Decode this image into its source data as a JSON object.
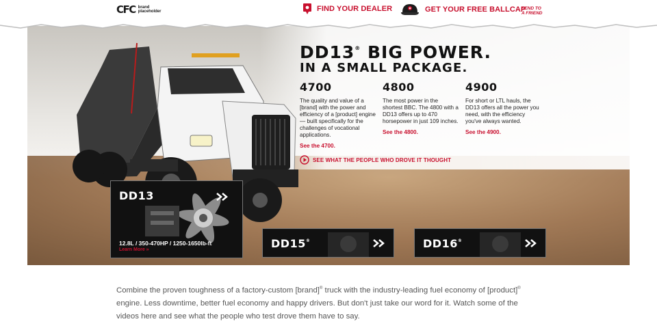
{
  "logo": {
    "main": "CFC",
    "sub_line1": "brand",
    "sub_line2": "placeholder"
  },
  "nav": {
    "dealer_label": "FIND YOUR DEALER",
    "ballcap_label": "GET YOUR FREE BALLCAP",
    "send_line1": "SEND TO",
    "send_line2": "A FRIEND"
  },
  "hero": {
    "headline_main": "DD13",
    "headline_reg": "®",
    "headline_rest": " BIG POWER.",
    "headline_line2": "IN A SMALL PACKAGE.",
    "models": [
      {
        "number": "4700",
        "description": "The quality and value of a [brand] with the power and efficiency of a [product] engine — built specifically for the challenges of vocational applications.",
        "link": "See the 4700."
      },
      {
        "number": "4800",
        "description": "The most power in the shortest BBC. The 4800 with a DD13 offers up to 470 horsepower in just 109 inches.",
        "link": "See the 4800."
      },
      {
        "number": "4900",
        "description": "For short or LTL hauls, the DD13 offers all the power you need, with the efficiency you've always wanted.",
        "link": "See the 4900."
      }
    ],
    "see_people": "SEE WHAT THE PEOPLE WHO DROVE IT THOUGHT"
  },
  "engines": {
    "dd13": {
      "title": "DD13",
      "reg": "",
      "spec": "12.8L / 350-470HP / 1250-1650lb-ft",
      "learn": "Learn More »"
    },
    "dd15": {
      "title": "DD15",
      "reg": "®"
    },
    "dd16": {
      "title": "DD16",
      "reg": "®"
    }
  },
  "body": {
    "text_a": "Combine the proven toughness of a factory-custom [brand]",
    "reg1": "®",
    "text_b": " truck with the industry-leading fuel economy of [product]",
    "reg2": "®",
    "text_c": " engine. Less downtime, better fuel economy and happy drivers. But don't just take our word for it. Watch some of the videos here and see what the people who test drove them have to say."
  },
  "colors": {
    "accent_red": "#c8102e",
    "card_black": "#111111"
  },
  "icons": [
    "pin-icon",
    "ballcap-icon",
    "play-circle-icon",
    "chevron-double-right-icon"
  ]
}
